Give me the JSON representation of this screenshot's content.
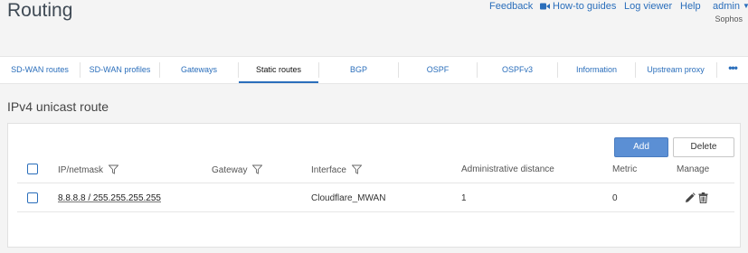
{
  "header": {
    "title": "Routing",
    "nav": {
      "feedback": "Feedback",
      "howto": "How-to guides",
      "logviewer": "Log viewer",
      "help": "Help",
      "admin": "admin"
    },
    "org": "Sophos"
  },
  "tabs": [
    {
      "label": "SD-WAN routes",
      "active": false
    },
    {
      "label": "SD-WAN profiles",
      "active": false
    },
    {
      "label": "Gateways",
      "active": false
    },
    {
      "label": "Static routes",
      "active": true
    },
    {
      "label": "BGP",
      "active": false
    },
    {
      "label": "OSPF",
      "active": false
    },
    {
      "label": "OSPFv3",
      "active": false
    },
    {
      "label": "Information",
      "active": false
    },
    {
      "label": "Upstream proxy",
      "active": false
    }
  ],
  "more_label": "•••",
  "section": {
    "title": "IPv4 unicast route",
    "buttons": {
      "add": "Add",
      "delete": "Delete"
    },
    "columns": {
      "ip_netmask": "IP/netmask",
      "gateway": "Gateway",
      "interface": "Interface",
      "admin_distance": "Administrative distance",
      "metric": "Metric",
      "manage": "Manage"
    },
    "rows": [
      {
        "ip_netmask": "8.8.8.8 / 255.255.255.255",
        "gateway": "",
        "interface": "Cloudflare_MWAN",
        "admin_distance": "1",
        "metric": "0"
      }
    ]
  },
  "colors": {
    "accent": "#2a6ebb",
    "add_button": "#5b8fd4",
    "background": "#f4f4f4"
  },
  "icons": [
    "video-icon",
    "caret-down-icon",
    "filter-icon",
    "edit-pencil-icon",
    "trash-icon"
  ]
}
